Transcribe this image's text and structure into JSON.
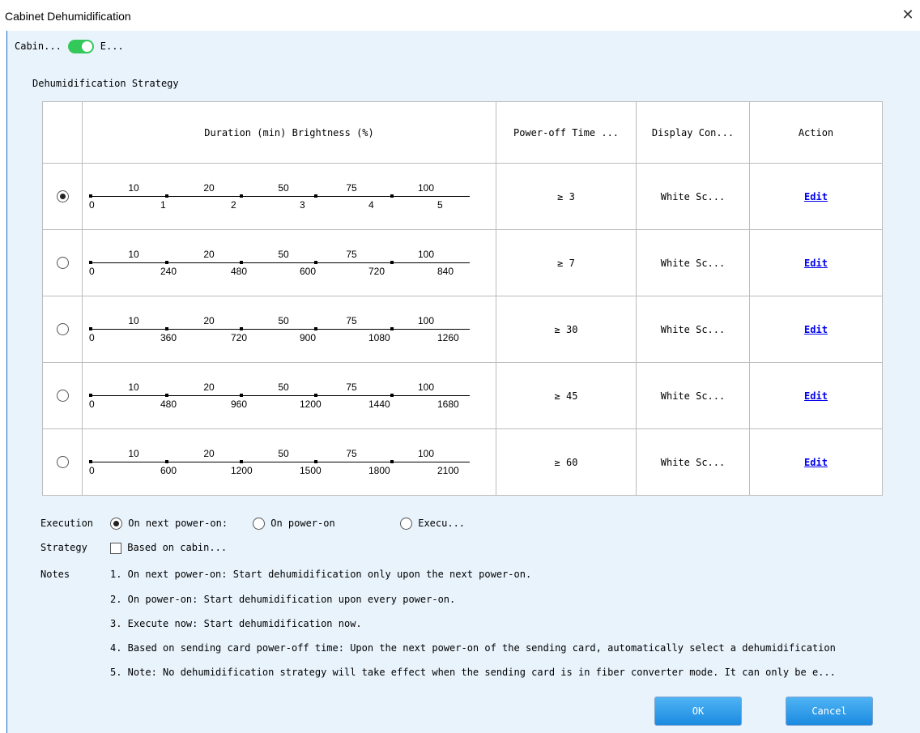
{
  "window": {
    "title": "Cabinet Dehumidification"
  },
  "toggle": {
    "left_label": "Cabin...",
    "right_label": "E...",
    "on": true
  },
  "section_title": "Dehumidification Strategy",
  "table": {
    "headers": {
      "duration_brightness": "Duration (min)  Brightness (%)",
      "power_off": "Power-off Time ...",
      "display": "Display Con...",
      "action": "Action"
    },
    "brightness_labels": [
      "10",
      "20",
      "50",
      "75",
      "100"
    ],
    "rows": [
      {
        "selected": true,
        "durations": [
          "0",
          "1",
          "2",
          "3",
          "4",
          "5"
        ],
        "power_off": "≥ 3",
        "display": "White Sc...",
        "action": "Edit"
      },
      {
        "selected": false,
        "durations": [
          "0",
          "240",
          "480",
          "600",
          "720",
          "840"
        ],
        "power_off": "≥ 7",
        "display": "White Sc...",
        "action": "Edit"
      },
      {
        "selected": false,
        "durations": [
          "0",
          "360",
          "720",
          "900",
          "1080",
          "1260"
        ],
        "power_off": "≥ 30",
        "display": "White Sc...",
        "action": "Edit"
      },
      {
        "selected": false,
        "durations": [
          "0",
          "480",
          "960",
          "1200",
          "1440",
          "1680"
        ],
        "power_off": "≥ 45",
        "display": "White Sc...",
        "action": "Edit"
      },
      {
        "selected": false,
        "durations": [
          "0",
          "600",
          "1200",
          "1500",
          "1800",
          "2100"
        ],
        "power_off": "≥ 60",
        "display": "White Sc...",
        "action": "Edit"
      }
    ]
  },
  "execution": {
    "label": "Execution",
    "options": [
      {
        "label": "On next power-on:",
        "checked": true
      },
      {
        "label": "On power-on",
        "checked": false
      },
      {
        "label": "Execu...",
        "checked": false
      }
    ]
  },
  "strategy": {
    "label": "Strategy",
    "checkbox_label": "Based on cabin...",
    "checked": false
  },
  "notes": {
    "label": "Notes",
    "items": [
      "1. On next power-on: Start dehumidification only upon the next power-on.",
      "2. On power-on: Start dehumidification upon every power-on.",
      "3. Execute now: Start dehumidification now.",
      "4. Based on sending card power-off time: Upon the next power-on of the sending card, automatically select a dehumidification",
      "5. Note: No dehumidification strategy will take effect when the sending card is in fiber converter mode. It can only be e..."
    ]
  },
  "buttons": {
    "ok": "OK",
    "cancel": "Cancel"
  },
  "colors": {
    "toggle_on": "#34c759",
    "link": "#0000ee",
    "panel_bg": "#e8f3fc",
    "button": "#1b8ae0"
  }
}
